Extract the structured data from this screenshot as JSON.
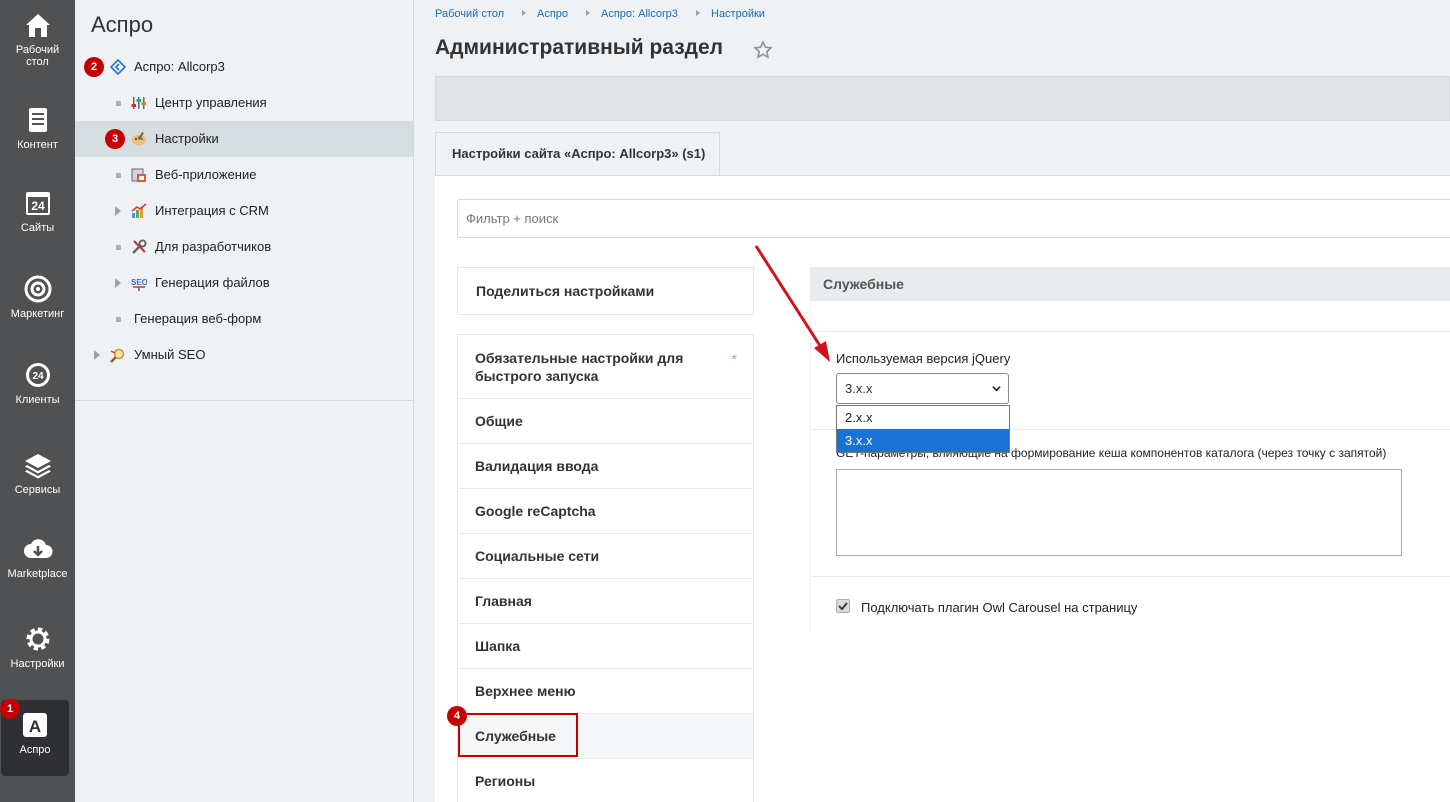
{
  "leftnav": {
    "items": [
      {
        "label": "Рабочий\nстол",
        "icon": "home-icon"
      },
      {
        "label": "Контент",
        "icon": "document-icon"
      },
      {
        "label": "Сайты",
        "icon": "calendar-24-icon"
      },
      {
        "label": "Маркетинг",
        "icon": "target-icon"
      },
      {
        "label": "Клиенты",
        "icon": "crm-24-icon"
      },
      {
        "label": "Сервисы",
        "icon": "layers-icon"
      },
      {
        "label": "Marketplace",
        "icon": "cloud-download-icon"
      },
      {
        "label": "Настройки",
        "icon": "gear-icon"
      },
      {
        "label": "Аспро",
        "icon": "aspro-a-icon",
        "badge": "1"
      }
    ],
    "label_home_1": "Рабочий",
    "label_home_2": "стол"
  },
  "sidebar": {
    "title": "Аспро",
    "items": [
      {
        "label": "Аспро: Allcorp3",
        "badge": "2"
      },
      {
        "label": "Центр управления"
      },
      {
        "label": "Настройки",
        "badge": "3"
      },
      {
        "label": "Веб-приложение"
      },
      {
        "label": "Интеграция с CRM"
      },
      {
        "label": "Для разработчиков"
      },
      {
        "label": "Генерация файлов"
      },
      {
        "label": "Генерация веб-форм"
      },
      {
        "label": "Умный SEO"
      }
    ]
  },
  "breadcrumb": [
    "Рабочий стол",
    "Аспро",
    "Аспро: Allcorp3",
    "Настройки"
  ],
  "page_title": "Административный раздел",
  "tab_label": "Настройки сайта «Аспро: Allcorp3» (s1)",
  "filter_placeholder": "Фильтр + поиск",
  "share_label": "Поделиться настройками",
  "menu": {
    "first_label": "Обязательные настройки для быстрого запуска",
    "first_marker": "*",
    "items": [
      "Общие",
      "Валидация ввода",
      "Google reCaptcha",
      "Социальные сети",
      "Главная",
      "Шапка",
      "Верхнее меню",
      "Служебные",
      "Регионы"
    ],
    "highlight_badge": "4"
  },
  "section": {
    "title": "Служебные",
    "jquery_label": "Используемая версия jQuery",
    "jquery_value": "3.x.x",
    "jquery_options": [
      "2.x.x",
      "3.x.x"
    ],
    "get_label": "GET-параметры, влияющие на формирование кеша компонентов каталога (через точку с запятой)",
    "owl_label": "Подключать плагин Owl Carousel на страницу",
    "owl_checked": true
  },
  "colors": {
    "accent": "#c60000",
    "link": "#2067b0",
    "select_highlight": "#1a73d4"
  }
}
